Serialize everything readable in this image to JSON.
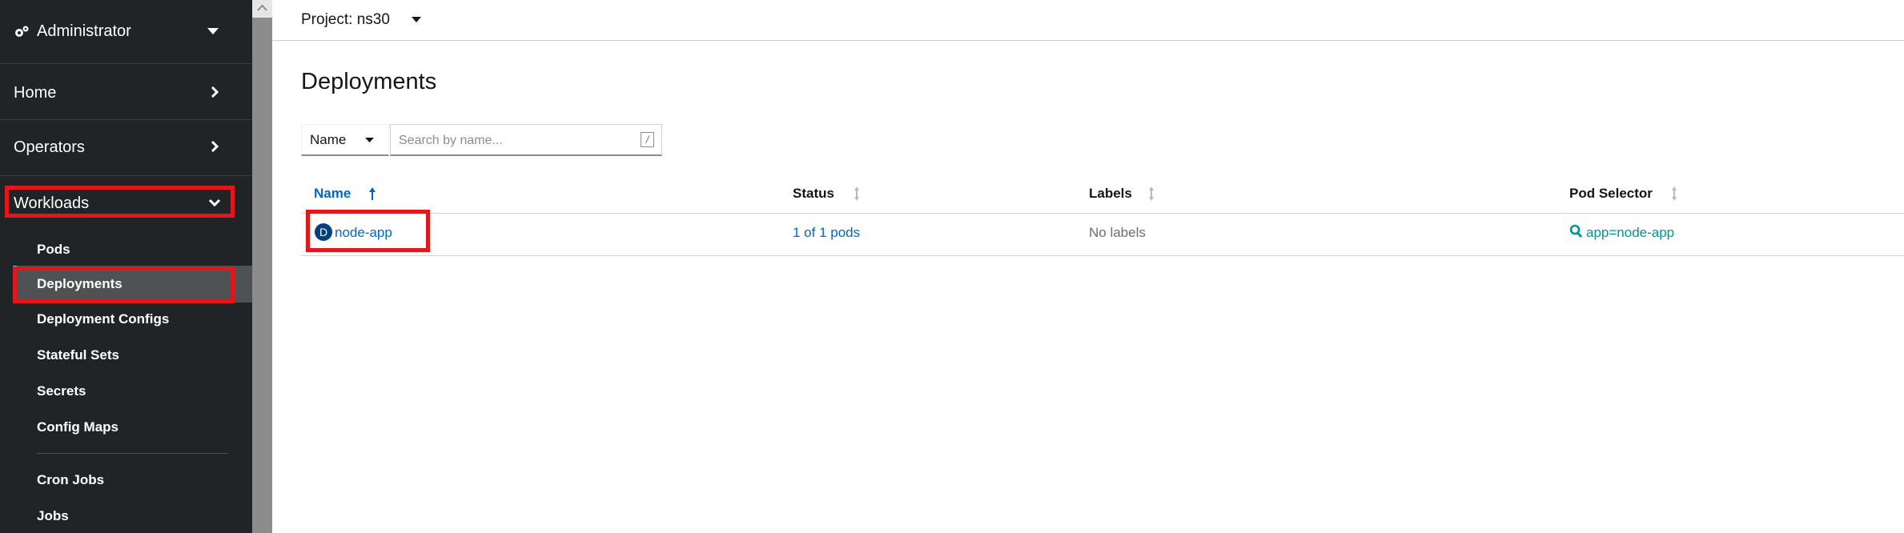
{
  "sidebar": {
    "perspective": "Administrator",
    "home": "Home",
    "operators": "Operators",
    "workloads": "Workloads",
    "workload_items": [
      "Pods",
      "Deployments",
      "Deployment Configs",
      "Stateful Sets",
      "Secrets",
      "Config Maps",
      "Cron Jobs",
      "Jobs"
    ]
  },
  "header": {
    "project": "Project: ns30"
  },
  "page": {
    "title": "Deployments"
  },
  "filter": {
    "type": "Name",
    "search_placeholder": "Search by name...",
    "shortcut": "/"
  },
  "table": {
    "columns": [
      "Name",
      "Status",
      "Labels",
      "Pod Selector"
    ],
    "rows": [
      {
        "badge": "D",
        "name": "node-app",
        "status": "1 of 1 pods",
        "labels": "No labels",
        "selector": "app=node-app"
      }
    ]
  },
  "colors": {
    "sidebar_bg": "#212427",
    "link": "#0066cc",
    "highlight": "#e3161a",
    "selector": "#009596"
  },
  "icons": [
    "cogs-icon",
    "caret-down-icon",
    "chevron-right-icon",
    "chevron-down-icon",
    "sort-up-icon",
    "sort-icon",
    "search-icon"
  ]
}
